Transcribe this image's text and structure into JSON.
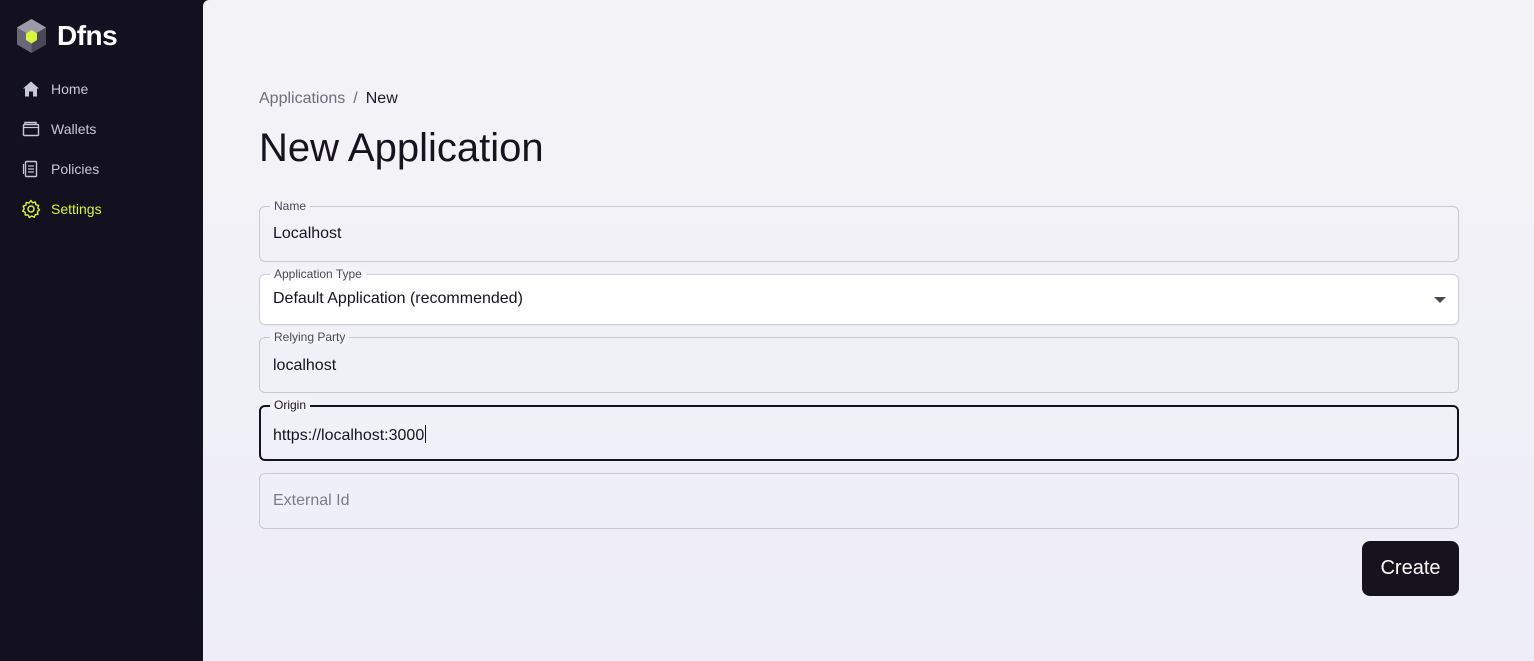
{
  "app": {
    "name": "Dfns"
  },
  "sidebar": {
    "items": [
      {
        "label": "Home",
        "icon": "home-icon",
        "active": false
      },
      {
        "label": "Wallets",
        "icon": "wallet-icon",
        "active": false
      },
      {
        "label": "Policies",
        "icon": "policy-icon",
        "active": false
      },
      {
        "label": "Settings",
        "icon": "gear-icon",
        "active": true
      }
    ],
    "active_color": "#d6f53c"
  },
  "breadcrumb": {
    "parent": "Applications",
    "separator": "/",
    "current": "New"
  },
  "page": {
    "title": "New Application"
  },
  "form": {
    "name": {
      "label": "Name",
      "value": "Localhost"
    },
    "application_type": {
      "label": "Application Type",
      "value": "Default Application (recommended)"
    },
    "relying_party": {
      "label": "Relying Party",
      "value": "localhost"
    },
    "origin": {
      "label": "Origin",
      "value": "https://localhost:3000"
    },
    "external_id": {
      "placeholder": "External Id",
      "value": ""
    },
    "submit_label": "Create"
  }
}
